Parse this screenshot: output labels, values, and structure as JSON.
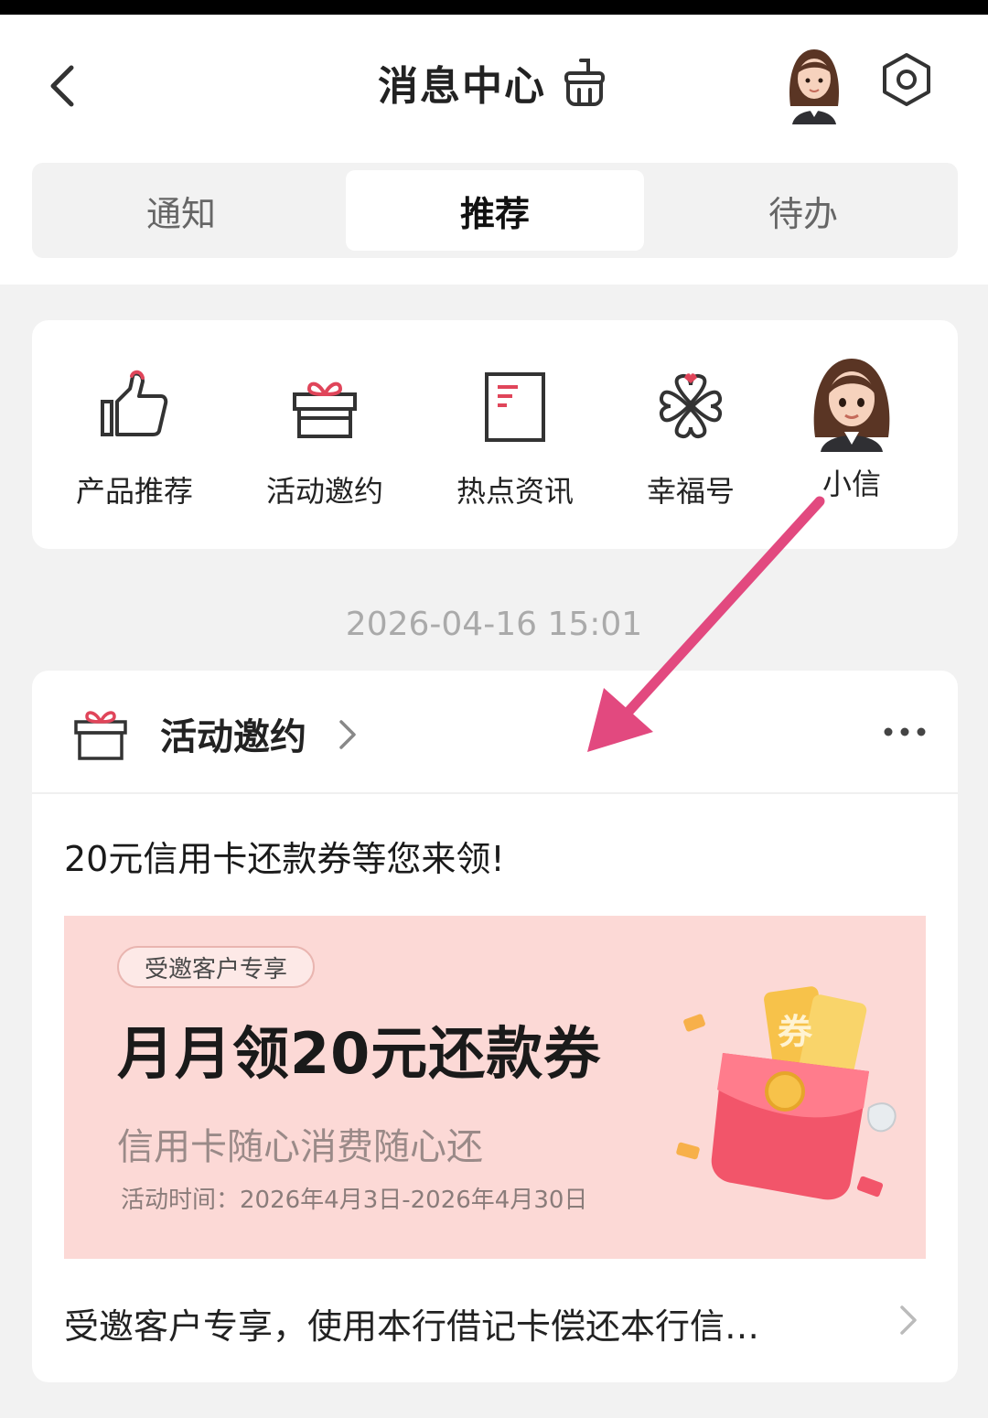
{
  "header": {
    "title": "消息中心"
  },
  "tabs": [
    {
      "label": "通知",
      "active": false
    },
    {
      "label": "推荐",
      "active": true
    },
    {
      "label": "待办",
      "active": false
    }
  ],
  "categories": [
    {
      "label": "产品推荐",
      "icon": "thumbs-up-icon"
    },
    {
      "label": "活动邀约",
      "icon": "gift-icon"
    },
    {
      "label": "热点资讯",
      "icon": "document-icon"
    },
    {
      "label": "幸福号",
      "icon": "clover-heart-icon"
    },
    {
      "label": "小信",
      "icon": "assistant-avatar"
    }
  ],
  "timestamp": "2026-04-16 15:01",
  "message": {
    "category": "活动邀约",
    "headline": "20元信用卡还款券等您来领!",
    "banner": {
      "badge": "受邀客户专享",
      "title": "月月领20元还款券",
      "subtitle": "信用卡随心消费随心还",
      "period": "活动时间：2026年4月3日-2026年4月30日",
      "coupon_text": "券"
    },
    "footer": "受邀客户专享，使用本行借记卡偿还本行信…"
  },
  "colors": {
    "accent": "#e0455a",
    "banner_bg": "#fcd9d6",
    "annotation_arrow": "#e2497f"
  }
}
